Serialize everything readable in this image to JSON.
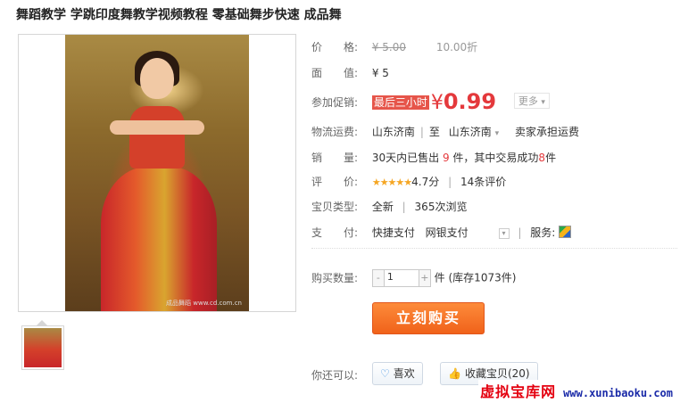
{
  "title": "舞蹈教学 学跳印度舞教学视频教程 零基础舞步快速 成品舞",
  "gallery": {
    "watermark": "成品舞蹈 www.cd.com.cn"
  },
  "price": {
    "label": "价　　格:",
    "original": "¥ 5.00",
    "discount": "10.00折"
  },
  "face_value": {
    "label": "面　　值:",
    "value": "¥ 5"
  },
  "promo": {
    "label": "参加促销:",
    "tag": "最后三小时",
    "currency": "¥",
    "price": "0.99",
    "more": "更多"
  },
  "shipping": {
    "label": "物流运费:",
    "from": "山东济南",
    "to_label": "至",
    "to": "山东济南",
    "fee": "卖家承担运费"
  },
  "sales": {
    "label": "销　　量:",
    "text_prefix": "30天内已售出",
    "sold": "9",
    "text_mid": "件，其中交易成功",
    "success": "8",
    "text_suffix": "件"
  },
  "rating": {
    "label": "评　　价:",
    "stars": "★★★★★",
    "score": "4.7分",
    "reviews": "14条评价"
  },
  "item_type": {
    "label": "宝贝类型:",
    "condition": "全新",
    "views": "365次浏览"
  },
  "payment": {
    "label": "支　　付:",
    "method1": "快捷支付",
    "method2": "网银支付",
    "service_label": "服务:"
  },
  "purchase": {
    "label": "购买数量:",
    "quantity": "1",
    "unit": "件",
    "stock": "(库存1073件)",
    "buy_label": "立刻购买"
  },
  "actions": {
    "label": "你还可以:",
    "like": "喜欢",
    "favorite": "收藏宝贝(20)"
  },
  "footer": {
    "brand": "虚拟宝库网",
    "url": "www.xunibaoku.com"
  },
  "colors": {
    "accent_red": "#e4393c",
    "buy_orange": "#f0621a",
    "star": "#f5a623"
  }
}
